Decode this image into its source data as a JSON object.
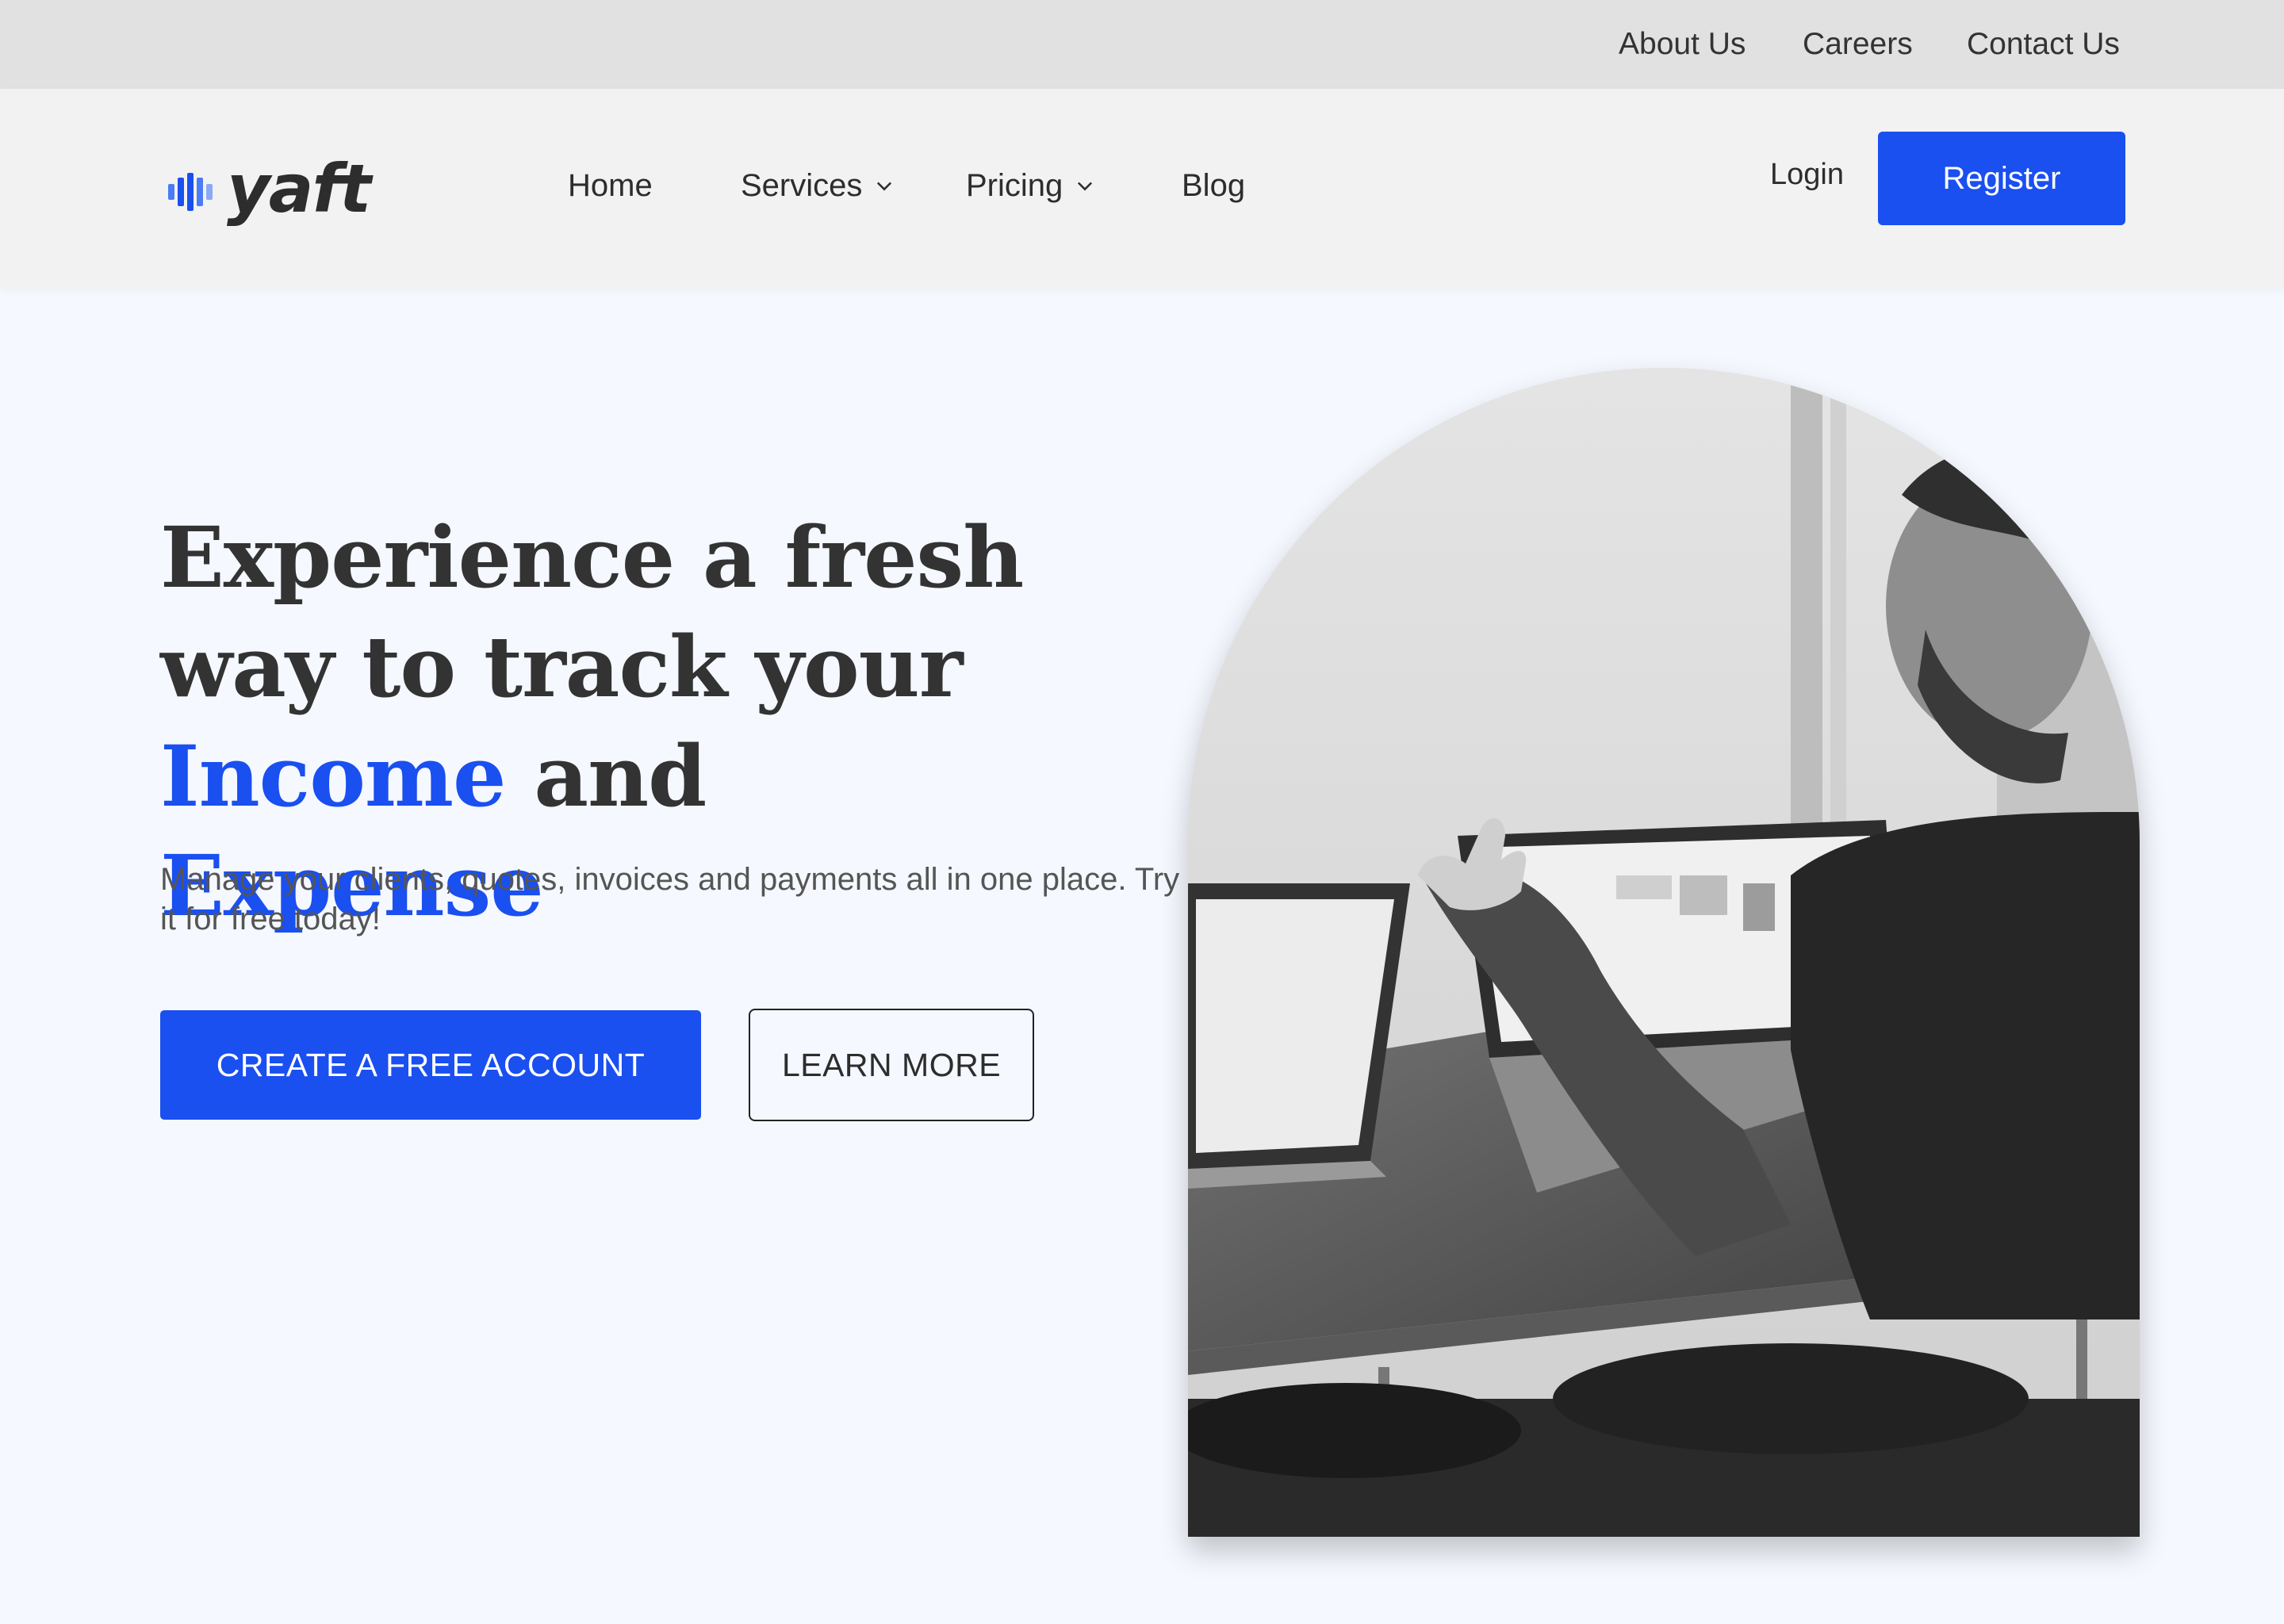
{
  "topbar": {
    "links": [
      "About Us",
      "Careers",
      "Contact Us"
    ]
  },
  "nav": {
    "logo_text": "yaft",
    "items": [
      {
        "label": "Home",
        "has_dropdown": false
      },
      {
        "label": "Services",
        "has_dropdown": true
      },
      {
        "label": "Pricing",
        "has_dropdown": true
      },
      {
        "label": "Blog",
        "has_dropdown": false
      }
    ],
    "login_label": "Login",
    "register_label": "Register"
  },
  "hero": {
    "headline_part1": "Experience a fresh way to track your ",
    "headline_accent1": "Income",
    "headline_part2": " and ",
    "headline_accent2": "Expense",
    "subtext": "Manage your clients, quotes, invoices and payments all in one place. Try it for free today!",
    "cta_primary": "CREATE A FREE ACCOUNT",
    "cta_secondary": "LEARN MORE"
  },
  "colors": {
    "accent": "#1a4ff0",
    "topbar_bg": "#e1e1e1",
    "navbar_bg": "#f2f2f2",
    "page_bg": "#f5f8fe"
  },
  "icons": {
    "logo_mark": "audio-bars-icon",
    "dropdown": "chevron-down-icon"
  }
}
